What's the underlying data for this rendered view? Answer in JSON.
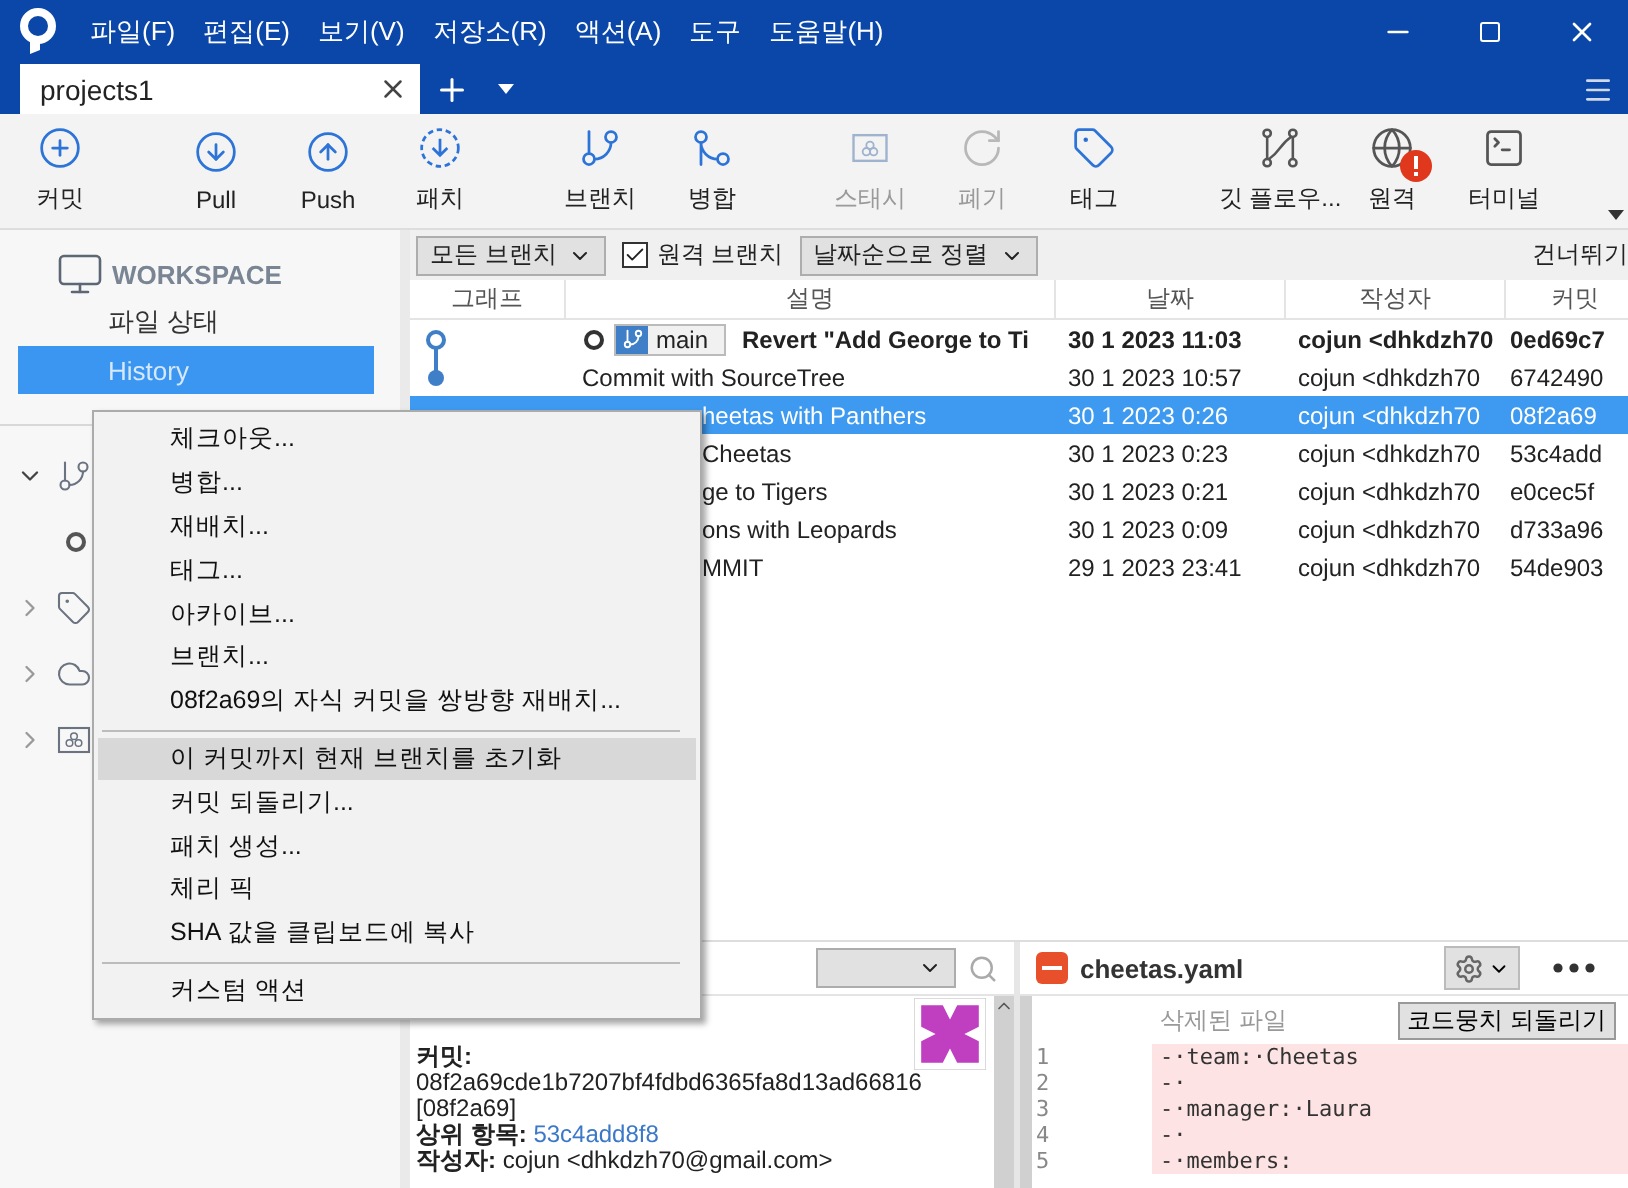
{
  "window": {
    "menus": [
      "파일(F)",
      "편집(E)",
      "보기(V)",
      "저장소(R)",
      "액션(A)",
      "도구",
      "도움말(H)"
    ]
  },
  "tabs": [
    {
      "label": "projects1",
      "selected": true
    }
  ],
  "toolbar": {
    "groups": [
      [
        {
          "kind": "commit",
          "label": "커밋",
          "disabled": false
        }
      ],
      [
        {
          "kind": "pull",
          "label": "Pull",
          "disabled": false
        },
        {
          "kind": "push",
          "label": "Push",
          "disabled": false
        },
        {
          "kind": "fetch",
          "label": "패치",
          "disabled": false
        }
      ],
      [
        {
          "kind": "branch",
          "label": "브랜치",
          "disabled": false
        },
        {
          "kind": "merge",
          "label": "병합",
          "disabled": false
        }
      ],
      [
        {
          "kind": "stash",
          "label": "스태시",
          "disabled": true
        },
        {
          "kind": "discard",
          "label": "폐기",
          "disabled": true
        },
        {
          "kind": "tag",
          "label": "태그",
          "disabled": false
        }
      ],
      [
        {
          "kind": "flow",
          "label": "깃 플로우...",
          "disabled": false
        },
        {
          "kind": "remote",
          "label": "원격",
          "disabled": false,
          "alert": true
        },
        {
          "kind": "terminal",
          "label": "터미널",
          "disabled": false
        }
      ]
    ]
  },
  "sidebar": {
    "section": "WORKSPACE",
    "items": [
      {
        "label": "파일 상태",
        "selected": false
      },
      {
        "label": "History",
        "selected": true
      }
    ],
    "tree": [
      {
        "kind": "branches",
        "expanded": true,
        "children": [
          {
            "kind": "head"
          }
        ]
      },
      {
        "kind": "tags",
        "expanded": false
      },
      {
        "kind": "remotes",
        "expanded": false
      },
      {
        "kind": "stashes",
        "expanded": false
      }
    ]
  },
  "filters": {
    "branch_filter": "모든 브랜치",
    "remote_branches": {
      "label": "원격 브랜치",
      "checked": true
    },
    "sort": "날짜순으로 정렬",
    "jump": "건너뛰기"
  },
  "table": {
    "columns": [
      "그래프",
      "설명",
      "날짜",
      "작성자",
      "커밋"
    ],
    "rows": [
      {
        "kind": "head",
        "branch": "main",
        "description": "Revert \"Add George to Ti",
        "date": "30 1 2023 11:03",
        "author": "cojun <dhkdzh70",
        "commit": "0ed69c7",
        "bold": true,
        "selected": false
      },
      {
        "kind": "commit",
        "description": "Commit with SourceTree",
        "date": "30 1 2023 10:57",
        "author": "cojun <dhkdzh70",
        "commit": "6742490",
        "bold": false,
        "selected": false
      },
      {
        "kind": "covered",
        "description": "heetas with Panthers",
        "date": "30 1 2023 0:26",
        "author": "cojun <dhkdzh70",
        "commit": "08f2a69",
        "bold": false,
        "selected": true
      },
      {
        "kind": "covered",
        "description": "Cheetas",
        "date": "30 1 2023 0:23",
        "author": "cojun <dhkdzh70",
        "commit": "53c4add",
        "bold": false,
        "selected": false
      },
      {
        "kind": "covered",
        "description": "ge to Tigers",
        "date": "30 1 2023 0:21",
        "author": "cojun <dhkdzh70",
        "commit": "e0cec5f",
        "bold": false,
        "selected": false
      },
      {
        "kind": "covered",
        "description": "ons with Leopards",
        "date": "30 1 2023 0:09",
        "author": "cojun <dhkdzh70",
        "commit": "d733a96",
        "bold": false,
        "selected": false
      },
      {
        "kind": "covered",
        "description": "MMIT",
        "date": "29 1 2023 23:41",
        "author": "cojun <dhkdzh70",
        "commit": "54de903",
        "bold": false,
        "selected": false
      }
    ]
  },
  "context_menu": {
    "items": [
      {
        "kind": "item",
        "label": "체크아웃...",
        "selected": false
      },
      {
        "kind": "item",
        "label": "병합...",
        "selected": false
      },
      {
        "kind": "item",
        "label": "재배치...",
        "selected": false
      },
      {
        "kind": "item",
        "label": "태그...",
        "selected": false
      },
      {
        "kind": "item",
        "label": "아카이브...",
        "selected": false
      },
      {
        "kind": "item",
        "label": "브랜치...",
        "selected": false
      },
      {
        "kind": "item",
        "label": "08f2a69의 자식 커밋을 쌍방향 재배치...",
        "selected": false
      },
      {
        "kind": "separator"
      },
      {
        "kind": "item",
        "label": "이 커밋까지 현재 브랜치를 초기화",
        "selected": true
      },
      {
        "kind": "item",
        "label": "커밋 되돌리기...",
        "selected": false
      },
      {
        "kind": "item",
        "label": "패치 생성...",
        "selected": false
      },
      {
        "kind": "item",
        "label": "체리 픽",
        "selected": false
      },
      {
        "kind": "item",
        "label": "SHA 값을 클립보드에 복사",
        "selected": false
      },
      {
        "kind": "separator"
      },
      {
        "kind": "item",
        "label": "커스텀 액션",
        "selected": false
      }
    ]
  },
  "commit_details": {
    "commit_label": "커밋:",
    "hash": "08f2a69cde1b7207bf4fdbd6365fa8d13ad66816",
    "short_hash": "[08f2a69]",
    "parent_label": "상위 항목:",
    "parent": "53c4add8f8",
    "author_label": "작성자:",
    "author": "cojun <dhkdzh70@gmail.com>"
  },
  "diff": {
    "file": "cheetas.yaml",
    "status": "삭제된 파일",
    "revert_button": "코드뭉치 되돌리기",
    "lines": [
      {
        "number": "1",
        "text": "-·team:·Cheetas"
      },
      {
        "number": "2",
        "text": "-·"
      },
      {
        "number": "3",
        "text": "-·manager:·Laura"
      },
      {
        "number": "4",
        "text": "-·"
      },
      {
        "number": "5",
        "text": "-·members:"
      }
    ]
  }
}
